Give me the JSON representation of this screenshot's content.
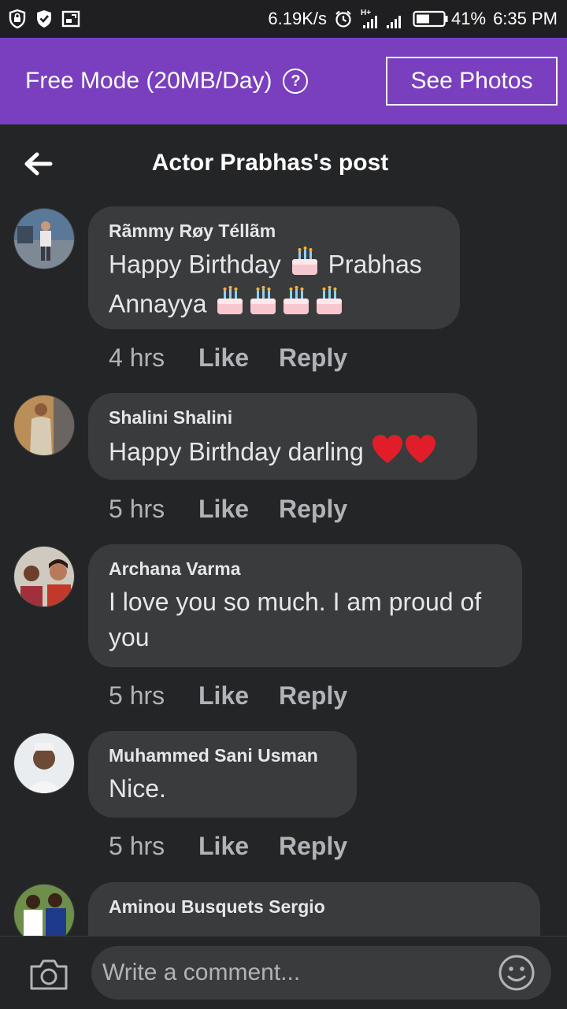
{
  "status_bar": {
    "speed": "6.19K/s",
    "network_type": "H+",
    "battery": "41%",
    "time": "6:35 PM"
  },
  "banner": {
    "mode_text": "Free Mode (20MB/Day)",
    "help_label": "?",
    "see_photos": "See Photos",
    "color": "#7a3fbf"
  },
  "header": {
    "title": "Actor Prabhas's post"
  },
  "comments": [
    {
      "author": "Rãmmy Røy Téllãm",
      "line1_a": "Happy Birthday",
      "line1_b": "Prabhas",
      "line2": "Annayya",
      "time": "4 hrs",
      "like": "Like",
      "reply": "Reply"
    },
    {
      "author": "Shalini Shalini",
      "text": "Happy Birthday darling",
      "time": "5 hrs",
      "like": "Like",
      "reply": "Reply"
    },
    {
      "author": "Archana Varma",
      "line1": "I love you so much. I am proud of",
      "line2": "you",
      "time": "5 hrs",
      "like": "Like",
      "reply": "Reply"
    },
    {
      "author": "Muhammed Sani Usman",
      "text": "Nice.",
      "time": "5 hrs",
      "like": "Like",
      "reply": "Reply"
    },
    {
      "author": "Aminou Busquets Sergio"
    }
  ],
  "composer": {
    "placeholder": "Write a comment..."
  },
  "icons": [
    "shield-icon",
    "check-shield-icon",
    "screen-icon",
    "alarm-icon",
    "signal-icon",
    "battery-icon",
    "back-arrow-icon",
    "help-icon",
    "cake-emoji",
    "heart-emoji",
    "camera-icon",
    "smiley-icon"
  ]
}
